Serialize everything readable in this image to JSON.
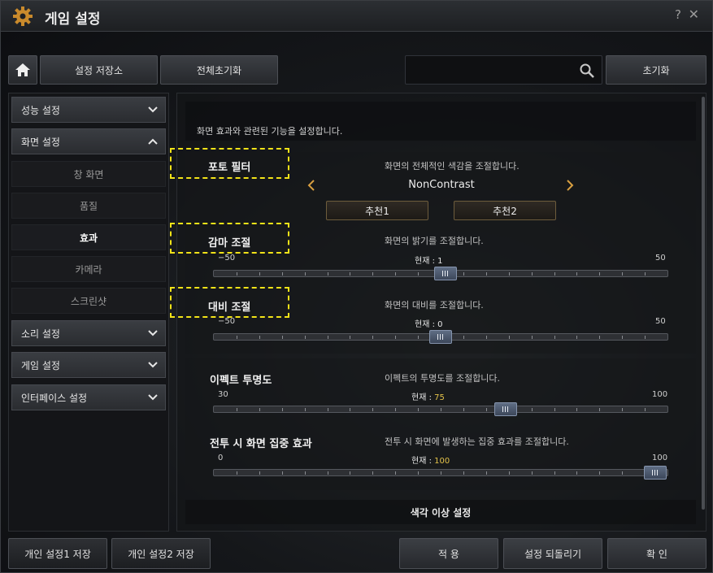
{
  "window": {
    "title": "게임 설정",
    "help": "?",
    "close": "✕"
  },
  "toolbar": {
    "home_icon": "home-icon",
    "storage": "설정 저장소",
    "reset_all": "전체초기화",
    "search_placeholder": "",
    "search_icon": "search-icon",
    "reset": "초기화"
  },
  "sidebar": {
    "items": [
      {
        "label": "성능 설정",
        "expanded": false
      },
      {
        "label": "화면 설정",
        "expanded": true
      },
      {
        "label": "소리 설정",
        "expanded": false
      },
      {
        "label": "게임 설정",
        "expanded": false
      },
      {
        "label": "인터페이스 설정",
        "expanded": false
      }
    ],
    "subitems": [
      "창 화면",
      "품질",
      "효과",
      "카메라",
      "스크린샷"
    ],
    "active_subitem": "효과"
  },
  "content": {
    "intro": "화면 효과와 관련된 기능을 설정합니다.",
    "photo_filter": {
      "title": "포토 필터",
      "desc": "화면의 전체적인 색감을 조절합니다.",
      "value": "NonContrast",
      "preset1": "추천1",
      "preset2": "추천2"
    },
    "gamma": {
      "title": "감마 조절",
      "desc": "화면의 밝기를 조절합니다.",
      "min": "−50",
      "max": "50",
      "current_label": "현재 : ",
      "current": "1",
      "current_num": 1
    },
    "contrast": {
      "title": "대비 조절",
      "desc": "화면의 대비를 조절합니다.",
      "min": "−50",
      "max": "50",
      "current_label": "현재 : ",
      "current": "0",
      "current_num": 0
    },
    "effect_opacity": {
      "title": "이펙트 투명도",
      "desc": "이펙트의 투명도를 조절합니다.",
      "min": "30",
      "max": "100",
      "current_label": "현재 : ",
      "current": "75",
      "current_num": 75
    },
    "combat_focus": {
      "title": "전투 시 화면 집중 효과",
      "desc": "전투 시 화면에 발생하는 집중 효과를 조절합니다.",
      "min": "0",
      "max": "100",
      "current_label": "현재 : ",
      "current": "100",
      "current_num": 100
    },
    "color_blind": "색각 이상 설정"
  },
  "footer": {
    "save1": "개인 설정1 저장",
    "save2": "개인 설정2 저장",
    "apply": "적 용",
    "revert": "설정 되돌리기",
    "ok": "확 인"
  },
  "colors": {
    "highlight": "#f2e318",
    "accent_value": "#e3c24a",
    "thumb": "#4b5870"
  }
}
